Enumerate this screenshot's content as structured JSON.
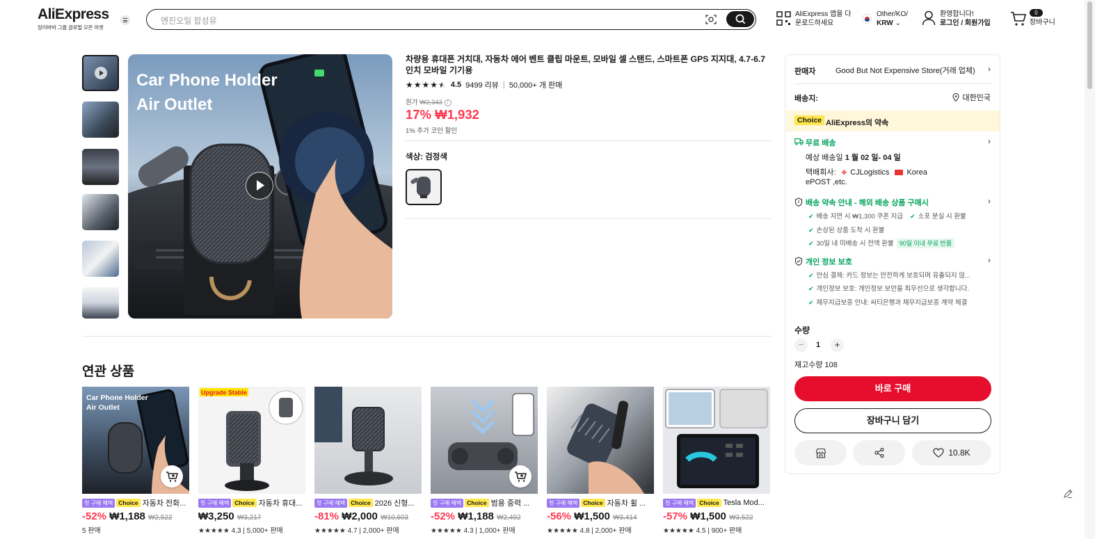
{
  "header": {
    "logo": "AliExpress",
    "logo_sub": "알리바바 그룹 글로벌 오픈 마켓",
    "search_placeholder": "엔진오일 합성유",
    "app_line1": "AliExpress 앱을 다",
    "app_line2": "운로드하세요",
    "region_line1": "Other/KO/",
    "region_line2": "KRW",
    "account_line1": "환영합니다!",
    "account_line2": "로그인 / 회원가입",
    "cart_count": "0",
    "cart_label": "장바구니"
  },
  "product": {
    "title": "차량용 휴대폰 거치대, 자동차 에어 벤트 클립 마운트, 모바일 셀 스탠드, 스마트폰 GPS 지지대, 4.7-6.7 인치 모바일 기기용",
    "rating": "4.5",
    "reviews": "9499 리뷰",
    "sold": "50,000+ 개 판매",
    "orig_label": "원가",
    "orig_price": "₩2,343",
    "price": "17% ₩1,932",
    "coin_note": "1% 추가 코인 할인",
    "color_label": "색상: 검정색",
    "image_line1": "Car Phone Holder",
    "image_line2": "Air Outlet"
  },
  "related": {
    "title": "연관 상품",
    "first_tag": "첫 구매 혜택",
    "choice_tag": "Choice",
    "items": [
      {
        "name": "자동차 전화...",
        "discount": "-52%",
        "price": "₩1,188",
        "orig": "₩2,522",
        "sold": "5 판매",
        "rating": "",
        "img_line1": "Car Phone Holder",
        "img_line2": "Air Outlet"
      },
      {
        "name": "자동차 휴대...",
        "discount": "",
        "price": "₩3,250",
        "orig": "₩3,217",
        "sold": "5,000+ 판매",
        "rating": "4.3",
        "img_banner": "Upgrade Stable"
      },
      {
        "name": "2026 신형...",
        "discount": "-81%",
        "price": "₩2,000",
        "orig": "₩10,603",
        "sold": "2,000+ 판매",
        "rating": "4.7"
      },
      {
        "name": "범용 중력 ...",
        "discount": "-52%",
        "price": "₩1,188",
        "orig": "₩2,492",
        "sold": "1,000+ 판매",
        "rating": "4.3"
      },
      {
        "name": "자동차 휠 ...",
        "discount": "-56%",
        "price": "₩1,500",
        "orig": "₩3,414",
        "sold": "2,000+ 판매",
        "rating": "4.8"
      },
      {
        "name": "Tesla Mod...",
        "discount": "-57%",
        "price": "₩1,500",
        "orig": "₩3,522",
        "sold": "900+ 판매",
        "rating": "4.5"
      }
    ]
  },
  "panel": {
    "seller_label": "판매자",
    "seller_name": "Good But Not Expensive Store(거래 업체)",
    "ship_to_label": "배송지:",
    "ship_to": "대한민국",
    "choice_badge": "Choice",
    "promise": "AliExpress의 약속",
    "free_shipping": "무료 배송",
    "delivery_prefix": "예상 배송일",
    "delivery_date": "1 월 02 일- 04 일",
    "carrier_label": "택배회사:",
    "carrier1": "CJLogistics",
    "carrier2": "Korea",
    "carrier3": "ePOST ,etc.",
    "guarantee_title": "배송 약속 안내 - 해외 배송 상품 구매시",
    "g1": "배송 지연 시 ₩1,300 쿠폰 지급",
    "g2": "소포 분실 시 환불",
    "g3": "손상된 상품 도착 시 환불",
    "g4": "30일 내 미배송 시 전액 환불",
    "g4_tag": "90일 이내 무료 반품",
    "privacy_title": "개인 정보 보호",
    "p1": "안심 결제: 카드 정보는 안전하게 보호되며 유출되지 않...",
    "p2": "개인정보 보호: 개인정보 보안을 최우선으로 생각합니다.",
    "p3": "채무지급보증 안내: 씨티은행과 채무지급보증 계약 체결",
    "qty_label": "수량",
    "qty_value": "1",
    "stock": "재고수량 108",
    "buy_now": "바로 구매",
    "add_cart": "장바구니 담기",
    "wishlist_count": "10.8K"
  }
}
